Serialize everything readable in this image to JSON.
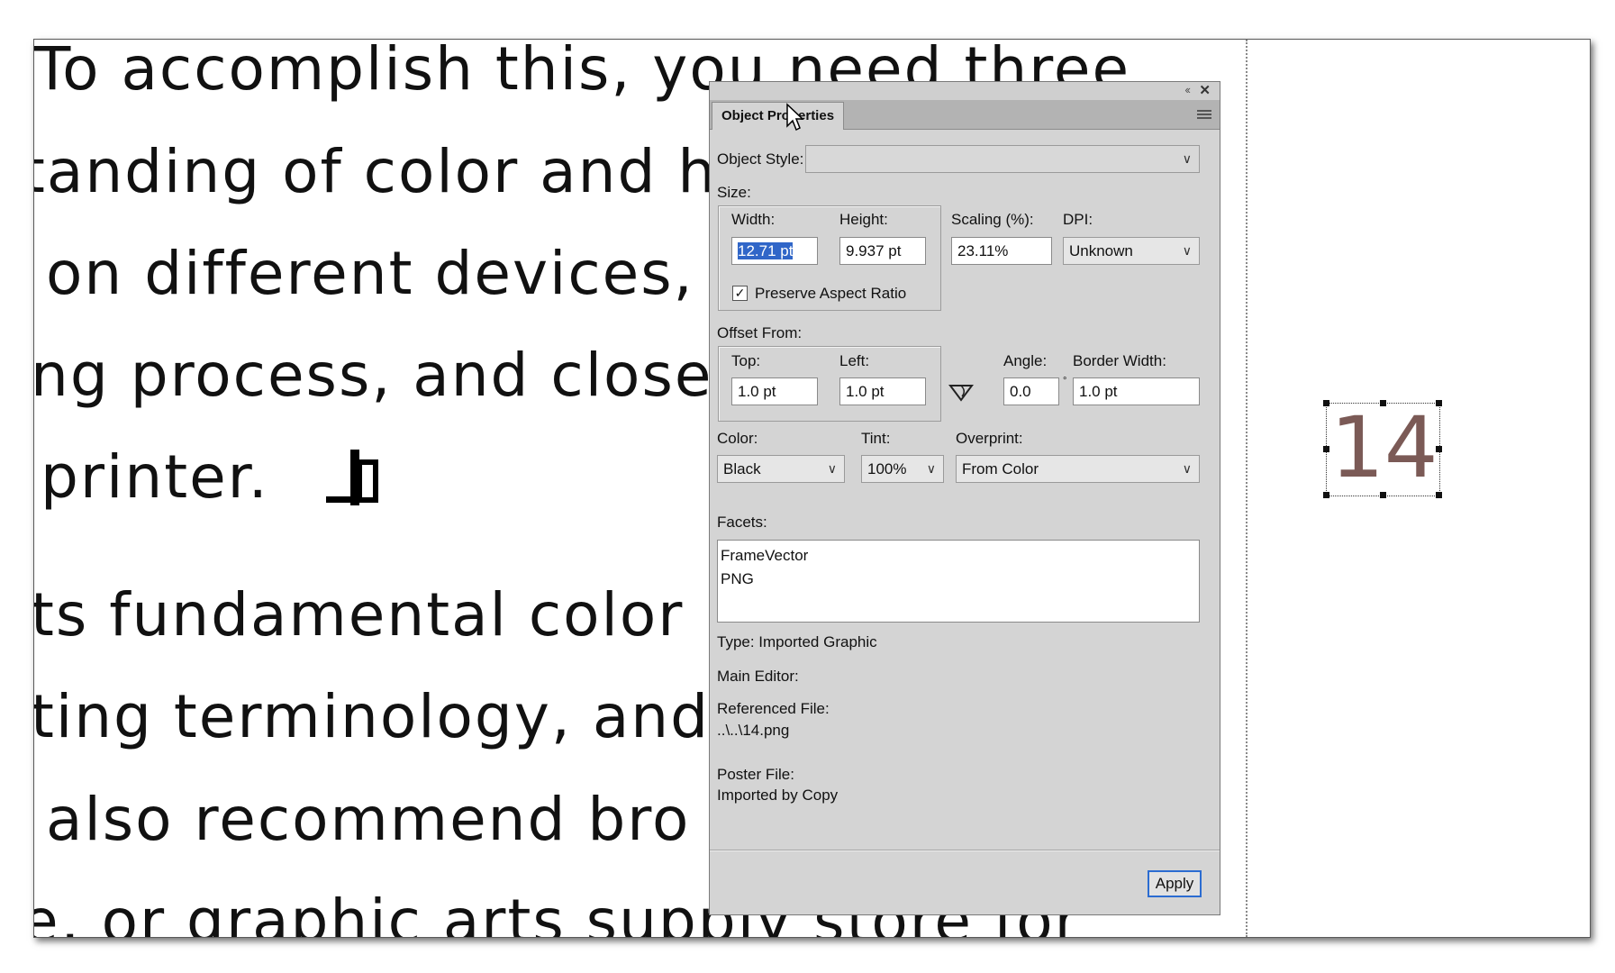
{
  "document": {
    "lines": [
      "To accomplish this, you need three",
      "tanding of color and h",
      "on different devices,",
      "ng process, and close",
      "printer.",
      "ts fundamental color",
      "ting terminology, and",
      "also recommend bro",
      "e, or graphic arts supply store for"
    ],
    "graphic_text": "14"
  },
  "panel": {
    "title": "Object Properties",
    "object_style": {
      "label": "Object Style:",
      "value": ""
    },
    "size": {
      "label": "Size:",
      "width_label": "Width:",
      "width_value": "12.71 pt",
      "height_label": "Height:",
      "height_value": "9.937 pt",
      "scaling_label": "Scaling (%):",
      "scaling_value": "23.11%",
      "dpi_label": "DPI:",
      "dpi_value": "Unknown",
      "preserve_label": "Preserve Aspect Ratio",
      "preserve_checked": true
    },
    "offset": {
      "label": "Offset From:",
      "top_label": "Top:",
      "top_value": "1.0 pt",
      "left_label": "Left:",
      "left_value": "1.0 pt",
      "angle_label": "Angle:",
      "angle_value": "0.0",
      "border_label": "Border Width:",
      "border_value": "1.0 pt"
    },
    "color": {
      "label": "Color:",
      "value": "Black"
    },
    "tint": {
      "label": "Tint:",
      "value": "100%"
    },
    "overprint": {
      "label": "Overprint:",
      "value": "From Color"
    },
    "facets": {
      "label": "Facets:",
      "items": [
        "FrameVector",
        "PNG"
      ]
    },
    "type": "Type: Imported Graphic",
    "main_editor": "Main Editor:",
    "referenced_file": {
      "label": "Referenced File:",
      "value": "..\\..\\14.png"
    },
    "poster_file": {
      "label": "Poster File:",
      "value": "Imported by Copy"
    },
    "apply_label": "Apply"
  },
  "colors": {
    "panel_bg": "#d4d4d4",
    "selection": "#3066c8",
    "graphic_digit": "#7b5a56",
    "apply_border": "#2b6cd1"
  }
}
